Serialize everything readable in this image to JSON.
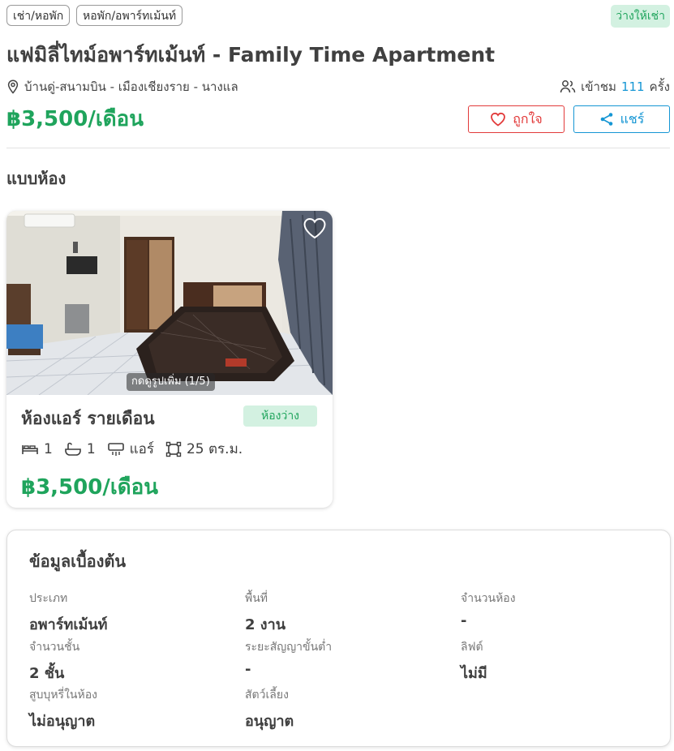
{
  "tags": [
    "เช่า/หอพัก",
    "หอพัก/อพาร์ทเม้นท์"
  ],
  "status": "ว่างให้เช่า",
  "title": "แฟมิลี่ไทม์อพาร์ทเม้นท์ - Family Time Apartment",
  "location": "บ้านดู่-สนามบิน - เมืองเชียงราย - นางแล",
  "views": {
    "prefix": "เข้าชม",
    "count": "111",
    "suffix": "ครั้ง"
  },
  "price": "฿3,500/เดือน",
  "buttons": {
    "like": "ถูกใจ",
    "share": "แชร์"
  },
  "room_section_title": "แบบห้อง",
  "room": {
    "photo_caption": "กดดูรูปเพิ่ม (1/5)",
    "name": "ห้องแอร์ รายเดือน",
    "badge": "ห้องว่าง",
    "beds": "1",
    "baths": "1",
    "aircon": "แอร์",
    "size": "25 ตร.ม.",
    "price": "฿3,500/เดือน"
  },
  "info": {
    "title": "ข้อมูลเบื้องต้น",
    "fields": [
      {
        "label": "ประเภท",
        "value": "อพาร์ทเม้นท์"
      },
      {
        "label": "พื้นที่",
        "value": "2 งาน"
      },
      {
        "label": "จำนวนห้อง",
        "value": "-"
      },
      {
        "label": "จำนวนชั้น",
        "value": "2 ชั้น"
      },
      {
        "label": "ระยะสัญญาขั้นต่ำ",
        "value": "-"
      },
      {
        "label": "ลิฟต์",
        "value": "ไม่มี"
      },
      {
        "label": "สูบบุหรี่ในห้อง",
        "value": "ไม่อนุญาต"
      },
      {
        "label": "สัตว์เลี้ยง",
        "value": "อนุญาต"
      }
    ]
  },
  "colors": {
    "accent_green": "#1fa45c",
    "accent_blue": "#1596d4",
    "like_red": "#e23a3a"
  },
  "icons": [
    "location-pin-icon",
    "users-icon",
    "heart-icon",
    "share-icon",
    "bed-icon",
    "bathtub-icon",
    "air-conditioner-icon",
    "area-icon"
  ]
}
